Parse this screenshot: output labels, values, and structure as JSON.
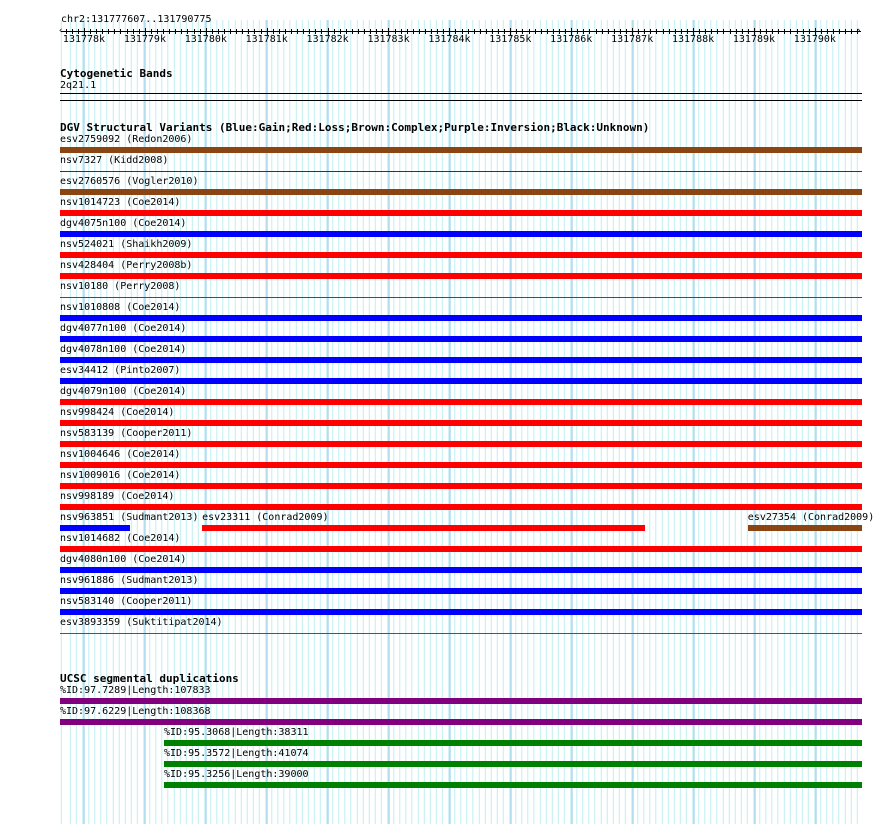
{
  "view": {
    "chrom": "chr2",
    "start": 131777607,
    "end": 131790775,
    "location_label": "chr2:131777607..131790775"
  },
  "axis": {
    "tick_labels": [
      "131778k",
      "131779k",
      "131780k",
      "131781k",
      "131782k",
      "131783k",
      "131784k",
      "131785k",
      "131786k",
      "131787k",
      "131788k",
      "131789k",
      "131790k"
    ],
    "tick_values_kb": [
      131778,
      131779,
      131780,
      131781,
      131782,
      131783,
      131784,
      131785,
      131786,
      131787,
      131788,
      131789,
      131790
    ]
  },
  "colors": {
    "brown": "#8B4513",
    "red": "#FF0000",
    "blue": "#0000FF",
    "purple": "#800080",
    "green": "#008000"
  },
  "cytobands": {
    "title": "Cytogenetic Bands",
    "band": "2q21.1"
  },
  "dgv": {
    "title": "DGV Structural Variants (Blue:Gain;Red:Loss;Brown:Complex;Purple:Inversion;Black:Unknown)",
    "rows": [
      [
        {
          "label": "esv2759092 (Redon2006)",
          "color": "brown",
          "start": 131777607,
          "end": 131790775
        }
      ],
      [
        {
          "label": "nsv7327 (Kidd2008)",
          "color": "purple",
          "thin": true,
          "start": 131777607,
          "end": 131790775
        }
      ],
      [
        {
          "label": "esv2760576 (Vogler2010)",
          "color": "brown",
          "start": 131777607,
          "end": 131790775
        }
      ],
      [
        {
          "label": "nsv1014723 (Coe2014)",
          "color": "red",
          "start": 131777607,
          "end": 131790775
        }
      ],
      [
        {
          "label": "dgv4075n100 (Coe2014)",
          "color": "blue",
          "start": 131777607,
          "end": 131790775
        }
      ],
      [
        {
          "label": "nsv524021 (Shaikh2009)",
          "color": "red",
          "start": 131777607,
          "end": 131790775
        }
      ],
      [
        {
          "label": "nsv428404 (Perry2008b)",
          "color": "red",
          "start": 131777607,
          "end": 131790775
        }
      ],
      [
        {
          "label": "nsv10180 (Perry2008)",
          "color": "red",
          "thin": true,
          "start": 131777607,
          "end": 131790775
        }
      ],
      [
        {
          "label": "nsv1010808 (Coe2014)",
          "color": "blue",
          "start": 131777607,
          "end": 131790775
        }
      ],
      [
        {
          "label": "dgv4077n100 (Coe2014)",
          "color": "blue",
          "start": 131777607,
          "end": 131790775
        }
      ],
      [
        {
          "label": "dgv4078n100 (Coe2014)",
          "color": "blue",
          "start": 131777607,
          "end": 131790775
        }
      ],
      [
        {
          "label": "esv34412 (Pinto2007)",
          "color": "blue",
          "start": 131777607,
          "end": 131790775
        }
      ],
      [
        {
          "label": "dgv4079n100 (Coe2014)",
          "color": "red",
          "start": 131777607,
          "end": 131790775
        }
      ],
      [
        {
          "label": "nsv998424 (Coe2014)",
          "color": "red",
          "start": 131777607,
          "end": 131790775
        }
      ],
      [
        {
          "label": "nsv583139 (Cooper2011)",
          "color": "red",
          "start": 131777607,
          "end": 131790775
        }
      ],
      [
        {
          "label": "nsv1004646 (Coe2014)",
          "color": "red",
          "start": 131777607,
          "end": 131790775
        }
      ],
      [
        {
          "label": "nsv1009016 (Coe2014)",
          "color": "red",
          "start": 131777607,
          "end": 131790775
        }
      ],
      [
        {
          "label": "nsv998189 (Coe2014)",
          "color": "red",
          "start": 131777607,
          "end": 131790775
        }
      ],
      [
        {
          "label": "nsv963851 (Sudmant2013)",
          "color": "blue",
          "start": 131777607,
          "end": 131778760
        },
        {
          "label": "esv23311 (Conrad2009)",
          "color": "red",
          "start": 131779940,
          "end": 131787210
        },
        {
          "label": "esv27354 (Conrad2009)",
          "color": "brown",
          "start": 131788900,
          "end": 131790775
        }
      ],
      [
        {
          "label": "nsv1014682 (Coe2014)",
          "color": "red",
          "start": 131777607,
          "end": 131790775
        }
      ],
      [
        {
          "label": "dgv4080n100 (Coe2014)",
          "color": "blue",
          "start": 131777607,
          "end": 131790775
        }
      ],
      [
        {
          "label": "nsv961886 (Sudmant2013)",
          "color": "blue",
          "start": 131777607,
          "end": 131790775
        }
      ],
      [
        {
          "label": "nsv583140 (Cooper2011)",
          "color": "blue",
          "start": 131777607,
          "end": 131790775
        }
      ],
      [
        {
          "label": "esv3893359 (Suktitipat2014)",
          "color": "brown",
          "thin": true,
          "start": 131777607,
          "end": 131790775
        }
      ]
    ]
  },
  "segdups": {
    "title": "UCSC segmental duplications",
    "rows": [
      [
        {
          "label": "%ID:97.7289|Length:107833",
          "color": "purple",
          "start": 131777607,
          "end": 131790775
        }
      ],
      [
        {
          "label": "%ID:97.6229|Length:108368",
          "color": "purple",
          "start": 131777607,
          "end": 131790775
        }
      ],
      [
        {
          "label": "%ID:95.3068|Length:38311",
          "color": "green",
          "start": 131779315,
          "end": 131790775
        }
      ],
      [
        {
          "label": "%ID:95.3572|Length:41074",
          "color": "green",
          "start": 131779315,
          "end": 131790775
        }
      ],
      [
        {
          "label": "%ID:95.3256|Length:39000",
          "color": "green",
          "start": 131779315,
          "end": 131790775
        }
      ]
    ]
  }
}
